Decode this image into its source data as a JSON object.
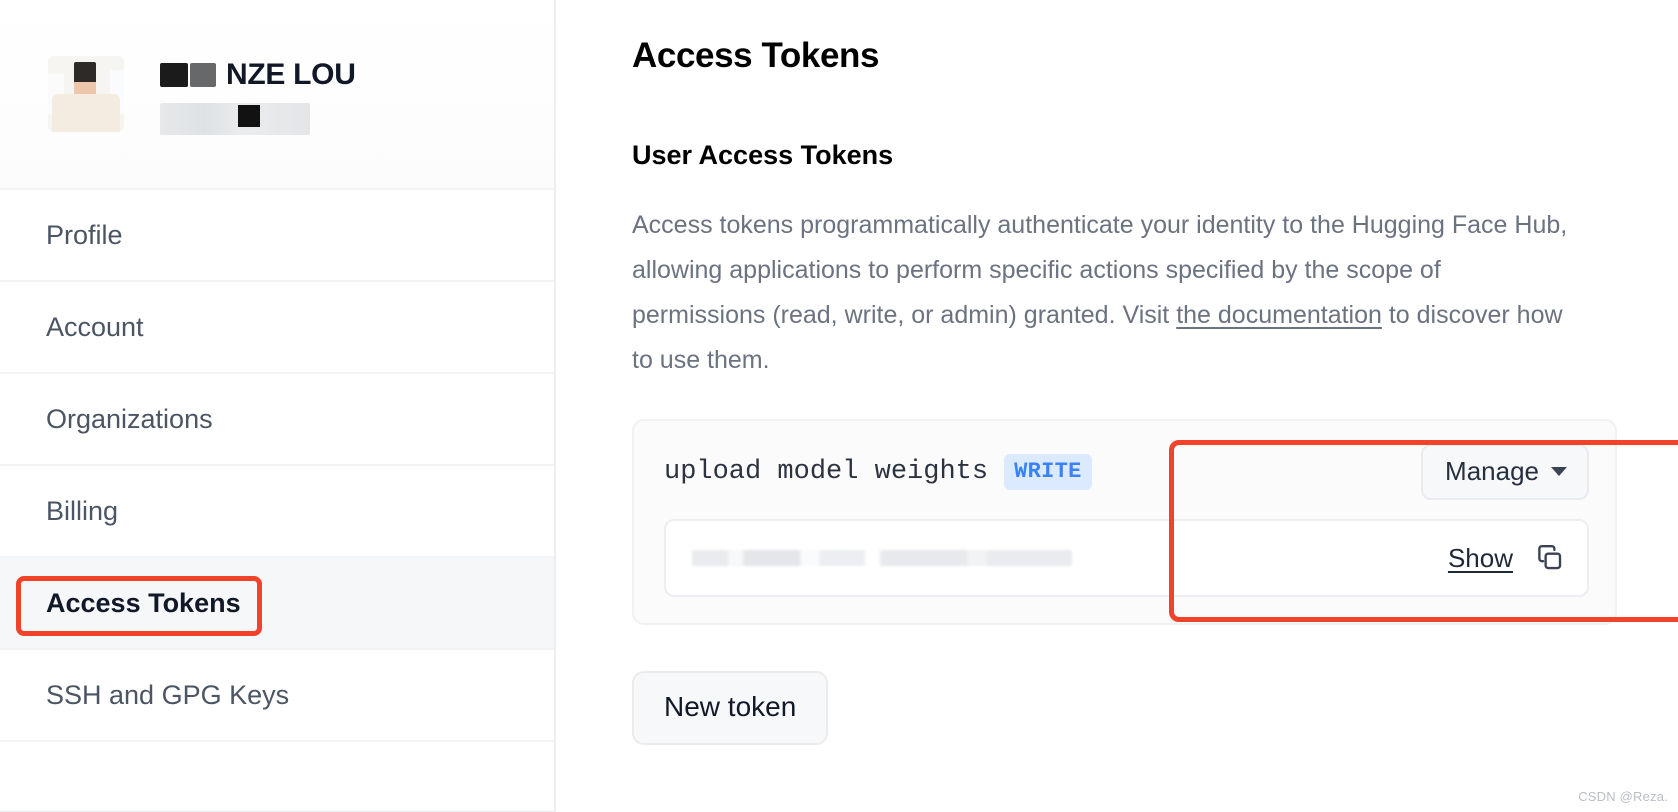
{
  "sidebar": {
    "profile": {
      "display_name": "NZE LOU",
      "name_redacted": true,
      "handle_redacted": true,
      "avatar_icon": "user-avatar-image"
    },
    "items": [
      {
        "label": "Profile",
        "active": false
      },
      {
        "label": "Account",
        "active": false
      },
      {
        "label": "Organizations",
        "active": false
      },
      {
        "label": "Billing",
        "active": false
      },
      {
        "label": "Access Tokens",
        "active": true
      },
      {
        "label": "SSH and GPG Keys",
        "active": false
      }
    ]
  },
  "main": {
    "page_title": "Access Tokens",
    "section_title": "User Access Tokens",
    "description": {
      "before_link": "Access tokens programmatically authenticate your identity to the Hugging Face Hub, allowing applications to perform specific actions specified by the scope of permissions (read, write, or admin) granted. Visit ",
      "link_text": "the documentation",
      "after_link": " to discover how to use them."
    },
    "token": {
      "name": "upload model weights",
      "role_badge": "WRITE",
      "manage_label": "Manage",
      "manage_chevron_icon": "chevron-down-icon",
      "value_masked": true,
      "show_label": "Show",
      "copy_icon": "copy-icon"
    },
    "new_token_label": "New token"
  },
  "annotations": {
    "highlight_color": "#f0432a",
    "targets": [
      "sidebar-item-access-tokens",
      "token-row"
    ]
  },
  "watermark": "CSDN @Reza.",
  "colors": {
    "badge_write_bg": "#dbeafe",
    "badge_write_text": "#3b82f6",
    "annotation": "#f0432a",
    "body_text": "#6b7280"
  }
}
